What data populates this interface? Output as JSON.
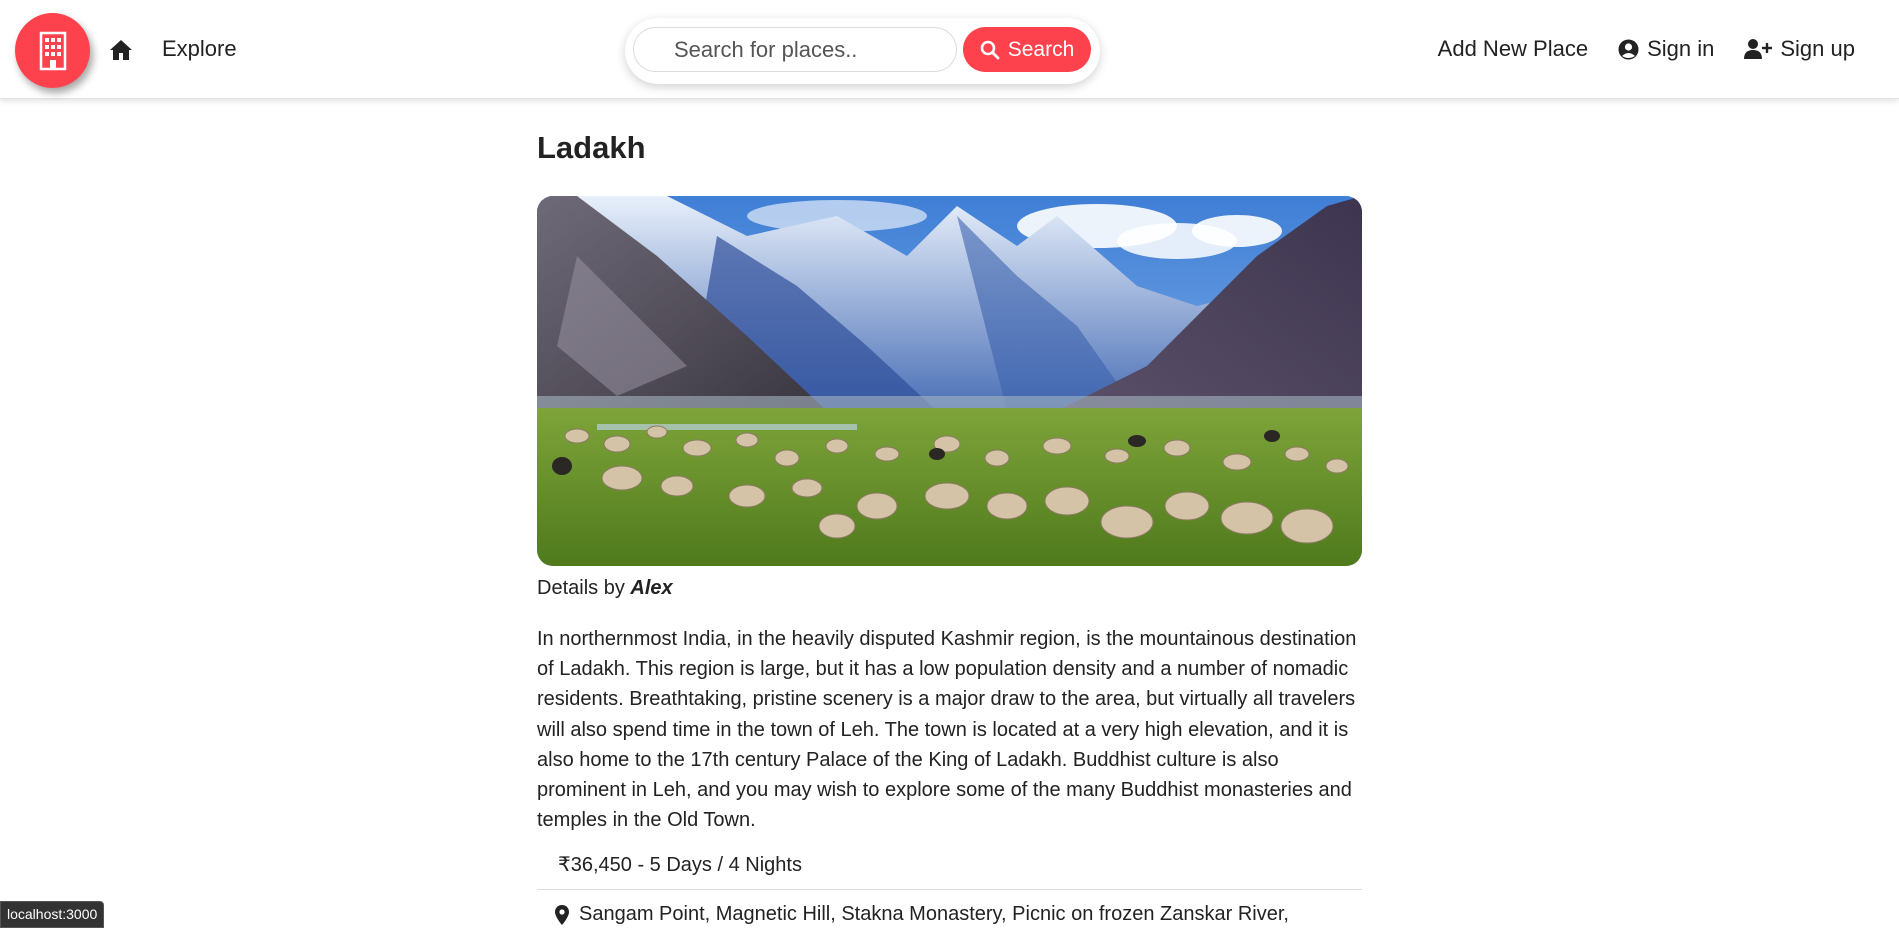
{
  "navbar": {
    "logo_icon": "building-icon",
    "home_icon": "home-icon",
    "explore_label": "Explore",
    "search": {
      "placeholder": "Search for places..",
      "value": "",
      "button_label": "Search",
      "button_icon": "search-icon"
    },
    "right_links": {
      "add_new_place": "Add New Place",
      "sign_in": "Sign in",
      "sign_in_icon": "user-circle-icon",
      "sign_up": "Sign up",
      "sign_up_icon": "user-plus-icon"
    }
  },
  "listing": {
    "title": "Ladakh",
    "image_alt": "Snowy mountains above a green valley with grazing sheep",
    "owner_prefix": "Details by",
    "owner_name": "Alex",
    "description": "In northernmost India, in the heavily disputed Kashmir region, is the mountainous destination of Ladakh. This region is large, but it has a low population density and a number of nomadic residents. Breathtaking, pristine scenery is a major draw to the area, but virtually all travelers will also spend time in the town of Leh. The town is located at a very high elevation, and it is also home to the 17th century Palace of the King of Ladakh. Buddhist culture is also prominent in Leh, and you may wish to explore some of the many Buddhist monasteries and temples in the Old Town.",
    "price": "₹36,450 - 5 Days / 4 Nights",
    "location_icon": "map-pin-icon",
    "location": "Sangam Point, Magnetic Hill, Stakna Monastery, Picnic on frozen Zanskar River,"
  },
  "status_bar": {
    "url": "localhost:3000"
  },
  "colors": {
    "accent": "#fe424d",
    "text": "#222222",
    "status_bar_bg": "#333333"
  }
}
